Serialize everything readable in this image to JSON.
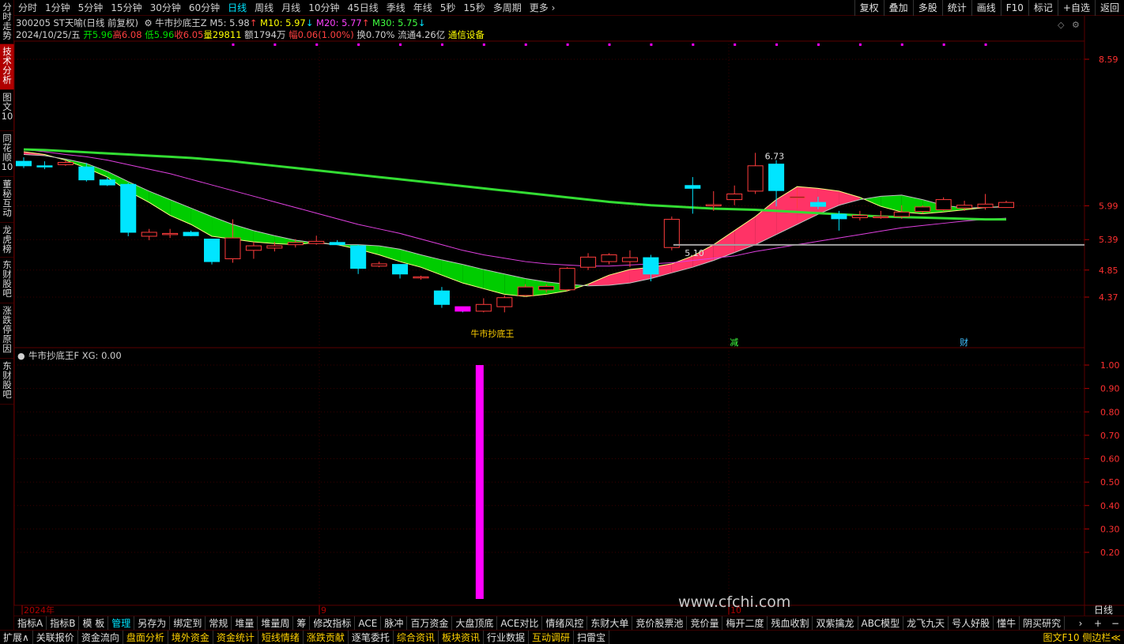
{
  "left_tabs": [
    "分时走势",
    "技术分析",
    "图文10",
    "同花顺10",
    "董秘互动",
    "龙虎榜",
    "东财股吧",
    "涨跌停原因",
    "东财股吧"
  ],
  "left_tab_active": 1,
  "periods": [
    "分时",
    "1分钟",
    "5分钟",
    "15分钟",
    "30分钟",
    "60分钟",
    "日线",
    "周线",
    "月线",
    "10分钟",
    "45日线",
    "季线",
    "年线",
    "5秒",
    "15秒",
    "多周期",
    "更多"
  ],
  "period_active": 6,
  "more_icon": "chevron-right-icon",
  "top_right": [
    "复权",
    "叠加",
    "多股",
    "统计",
    "画线",
    "F10",
    "标记",
    "+自选",
    "返回"
  ],
  "info": {
    "code_name": "300205 ST天喻(日线 前复权)",
    "indicator_name": "牛市抄底王Z",
    "m5": "M5: 5.98",
    "m5_arrow": "↑",
    "m10": "M10: 5.97",
    "m10_arrow": "↓",
    "m20": "M20: 5.77",
    "m20_arrow": "↑",
    "m30": "M30: 5.75",
    "m30_arrow": "↓",
    "date": "2024/10/25/五",
    "open": "开5.96",
    "high": "高6.08",
    "low": "低5.96",
    "close": "收6.05",
    "volume": "量29811",
    "amount": "额1794万",
    "change": "幅0.06(1.00%)",
    "turnover": "换0.70%",
    "float_cap": "流通4.26亿",
    "industry": "通信设备"
  },
  "price_axis": [
    "8.59",
    "5.99",
    "5.39",
    "4.85",
    "4.37"
  ],
  "main_labels": {
    "high_mark": "6.73",
    "support_level": "5.10",
    "signal_text": "牛市抄底王",
    "marker_jian": "减",
    "marker_cai": "财"
  },
  "sub_panel": {
    "title": "牛市抄底王F XG: 0.00",
    "axis": [
      "1.00",
      "0.90",
      "0.80",
      "0.70",
      "0.60",
      "0.50",
      "0.40",
      "0.30",
      "0.20"
    ],
    "bar_value": 1.0
  },
  "date_axis": [
    "2024年",
    "9",
    "10"
  ],
  "watermark": "www.cfchi.com",
  "period_label": "日线",
  "indicators": [
    "指标A",
    "指标B",
    "模 板",
    "管理",
    "另存为",
    "绑定到",
    "常规",
    "堆量",
    "堆量周",
    "筹",
    "修改指标",
    "ACE",
    "脉冲",
    "百万资金",
    "大盘顶底",
    "ACE对比",
    "情绪风控",
    "东财大单",
    "竞价股票池",
    "竞价量",
    "梅开二度",
    "残血收割",
    "双紫擒龙",
    "ABC模型",
    "龙飞九天",
    "号人好股",
    "懂牛",
    "阴买研究"
  ],
  "indicator_active": 3,
  "nav": [
    "›",
    "+",
    "−"
  ],
  "status": [
    {
      "label": "扩展∧",
      "color": "w"
    },
    {
      "label": "关联报价",
      "color": "w"
    },
    {
      "label": "资金流向",
      "color": "w"
    },
    {
      "label": "盘面分析",
      "color": "y"
    },
    {
      "label": "境外资金",
      "color": "y"
    },
    {
      "label": "资金统计",
      "color": "y"
    },
    {
      "label": "短线情绪",
      "color": "y"
    },
    {
      "label": "涨跌贡献",
      "color": "y"
    },
    {
      "label": "逐笔委托",
      "color": "w"
    },
    {
      "label": "综合资讯",
      "color": "y"
    },
    {
      "label": "板块资讯",
      "color": "y"
    },
    {
      "label": "行业数据",
      "color": "w"
    },
    {
      "label": "互动调研",
      "color": "y"
    },
    {
      "label": "扫雷宝",
      "color": "w"
    }
  ],
  "status_right": "图文F10 侧边栏≪",
  "colors": {
    "up": "#ff3c3c",
    "down": "#00e5ff",
    "ma_long": "#33dd33",
    "ma_mid": "#e040e0",
    "ribbon_green": "#00cc00",
    "ribbon_red": "#ff3366",
    "signal_bar": "#ff00ff"
  },
  "chart_data": {
    "type": "candlestick",
    "x": [
      "1",
      "2",
      "3",
      "4",
      "5",
      "6",
      "7",
      "8",
      "9",
      "10",
      "11",
      "12",
      "13",
      "14",
      "15",
      "16",
      "17",
      "18",
      "19",
      "20",
      "21",
      "22",
      "23",
      "24",
      "25",
      "26",
      "27",
      "28",
      "29",
      "30",
      "31",
      "32",
      "33",
      "34",
      "35",
      "36",
      "37",
      "38",
      "39",
      "40",
      "41",
      "42",
      "43",
      "44",
      "45",
      "46",
      "47",
      "48"
    ],
    "ohlc": [
      [
        6.78,
        6.85,
        6.66,
        6.7
      ],
      [
        6.7,
        6.78,
        6.64,
        6.68
      ],
      [
        6.72,
        6.8,
        6.7,
        6.76
      ],
      [
        6.68,
        6.75,
        6.42,
        6.45
      ],
      [
        6.45,
        6.5,
        6.34,
        6.36
      ],
      [
        6.37,
        6.4,
        5.45,
        5.52
      ],
      [
        5.45,
        5.58,
        5.38,
        5.52
      ],
      [
        5.48,
        5.58,
        5.42,
        5.5
      ],
      [
        5.52,
        5.55,
        5.45,
        5.46
      ],
      [
        5.4,
        5.4,
        4.95,
        5.0
      ],
      [
        5.05,
        5.75,
        4.98,
        5.42
      ],
      [
        5.2,
        5.35,
        5.05,
        5.28
      ],
      [
        5.24,
        5.35,
        5.18,
        5.28
      ],
      [
        5.3,
        5.4,
        5.25,
        5.34
      ],
      [
        5.32,
        5.46,
        5.3,
        5.36
      ],
      [
        5.34,
        5.38,
        5.3,
        5.3
      ],
      [
        5.28,
        5.3,
        4.78,
        4.88
      ],
      [
        4.92,
        5.0,
        4.9,
        4.96
      ],
      [
        4.95,
        4.95,
        4.7,
        4.78
      ],
      [
        4.72,
        4.75,
        4.68,
        4.73
      ],
      [
        4.48,
        4.55,
        4.18,
        4.24
      ],
      [
        4.2,
        4.2,
        4.1,
        4.12
      ],
      [
        4.12,
        4.35,
        4.1,
        4.24
      ],
      [
        4.2,
        4.4,
        4.1,
        4.36
      ],
      [
        4.4,
        4.6,
        4.38,
        4.55
      ],
      [
        4.5,
        4.6,
        4.45,
        4.56
      ],
      [
        4.5,
        4.9,
        4.48,
        4.88
      ],
      [
        4.9,
        5.15,
        4.85,
        5.08
      ],
      [
        5.0,
        5.15,
        4.95,
        5.12
      ],
      [
        5.0,
        5.2,
        4.9,
        5.07
      ],
      [
        5.07,
        5.12,
        4.65,
        4.78
      ],
      [
        5.25,
        5.8,
        5.2,
        5.75
      ],
      [
        6.35,
        6.5,
        5.85,
        6.3
      ],
      [
        5.99,
        6.25,
        5.9,
        6.01
      ],
      [
        6.1,
        6.35,
        6.0,
        6.2
      ],
      [
        6.25,
        6.93,
        6.2,
        6.7
      ],
      [
        6.73,
        6.8,
        5.98,
        6.26
      ],
      [
        6.15,
        6.3,
        5.95,
        6.15
      ],
      [
        6.05,
        6.15,
        5.93,
        5.98
      ],
      [
        5.84,
        5.9,
        5.55,
        5.76
      ],
      [
        5.78,
        5.9,
        5.73,
        5.82
      ],
      [
        5.79,
        5.9,
        5.76,
        5.8
      ],
      [
        5.8,
        6.0,
        5.76,
        5.88
      ],
      [
        5.89,
        6.0,
        5.85,
        5.97
      ],
      [
        5.92,
        6.14,
        5.9,
        6.1
      ],
      [
        5.95,
        6.08,
        5.9,
        6.0
      ],
      [
        5.96,
        6.2,
        5.92,
        6.02
      ],
      [
        5.96,
        6.08,
        5.96,
        6.05
      ]
    ],
    "series": [
      {
        "name": "M5",
        "values": [
          6.95,
          6.9,
          6.8,
          6.66,
          6.5,
          6.25,
          6.05,
          5.82,
          5.66,
          5.45,
          5.4,
          5.35,
          5.32,
          5.3,
          5.34,
          5.3,
          5.22,
          5.12,
          5.0,
          4.9,
          4.76,
          4.62,
          4.52,
          4.42,
          4.38,
          4.42,
          4.48,
          4.6,
          4.76,
          4.86,
          4.9,
          4.96,
          5.1,
          5.3,
          5.55,
          5.8,
          6.1,
          6.33,
          6.3,
          6.25,
          6.14,
          5.98,
          5.88,
          5.85,
          5.88,
          5.92,
          5.96,
          5.98
        ]
      },
      {
        "name": "M10",
        "values": [
          6.9,
          6.88,
          6.82,
          6.74,
          6.6,
          6.42,
          6.25,
          6.1,
          5.95,
          5.8,
          5.66,
          5.55,
          5.46,
          5.38,
          5.33,
          5.3,
          5.3,
          5.28,
          5.22,
          5.12,
          5.03,
          4.95,
          4.86,
          4.78,
          4.7,
          4.64,
          4.6,
          4.57,
          4.58,
          4.62,
          4.7,
          4.8,
          4.9,
          5.02,
          5.16,
          5.3,
          5.48,
          5.66,
          5.84,
          6.0,
          6.1,
          6.16,
          6.18,
          6.1,
          6.0,
          5.95,
          5.96,
          5.97
        ]
      },
      {
        "name": "M20",
        "values": [
          6.99,
          6.95,
          6.9,
          6.86,
          6.8,
          6.72,
          6.64,
          6.56,
          6.46,
          6.36,
          6.26,
          6.16,
          6.06,
          5.96,
          5.86,
          5.76,
          5.66,
          5.58,
          5.5,
          5.4,
          5.3,
          5.2,
          5.12,
          5.06,
          5.0,
          4.96,
          4.94,
          4.92,
          4.92,
          4.94,
          4.96,
          4.98,
          5.02,
          5.06,
          5.1,
          5.18,
          5.24,
          5.3,
          5.36,
          5.42,
          5.48,
          5.54,
          5.6,
          5.64,
          5.68,
          5.72,
          5.75,
          5.77
        ]
      },
      {
        "name": "M30",
        "values": [
          6.99,
          6.98,
          6.96,
          6.94,
          6.92,
          6.9,
          6.88,
          6.86,
          6.84,
          6.81,
          6.78,
          6.74,
          6.7,
          6.66,
          6.62,
          6.58,
          6.54,
          6.5,
          6.46,
          6.42,
          6.38,
          6.34,
          6.3,
          6.26,
          6.22,
          6.18,
          6.14,
          6.1,
          6.06,
          6.03,
          6.0,
          5.98,
          5.96,
          5.94,
          5.93,
          5.92,
          5.9,
          5.88,
          5.86,
          5.84,
          5.82,
          5.8,
          5.79,
          5.78,
          5.77,
          5.76,
          5.75,
          5.75
        ]
      }
    ],
    "signal": {
      "index": 22,
      "value": 1.0
    },
    "xg_range": [
      0,
      1.0
    ]
  }
}
